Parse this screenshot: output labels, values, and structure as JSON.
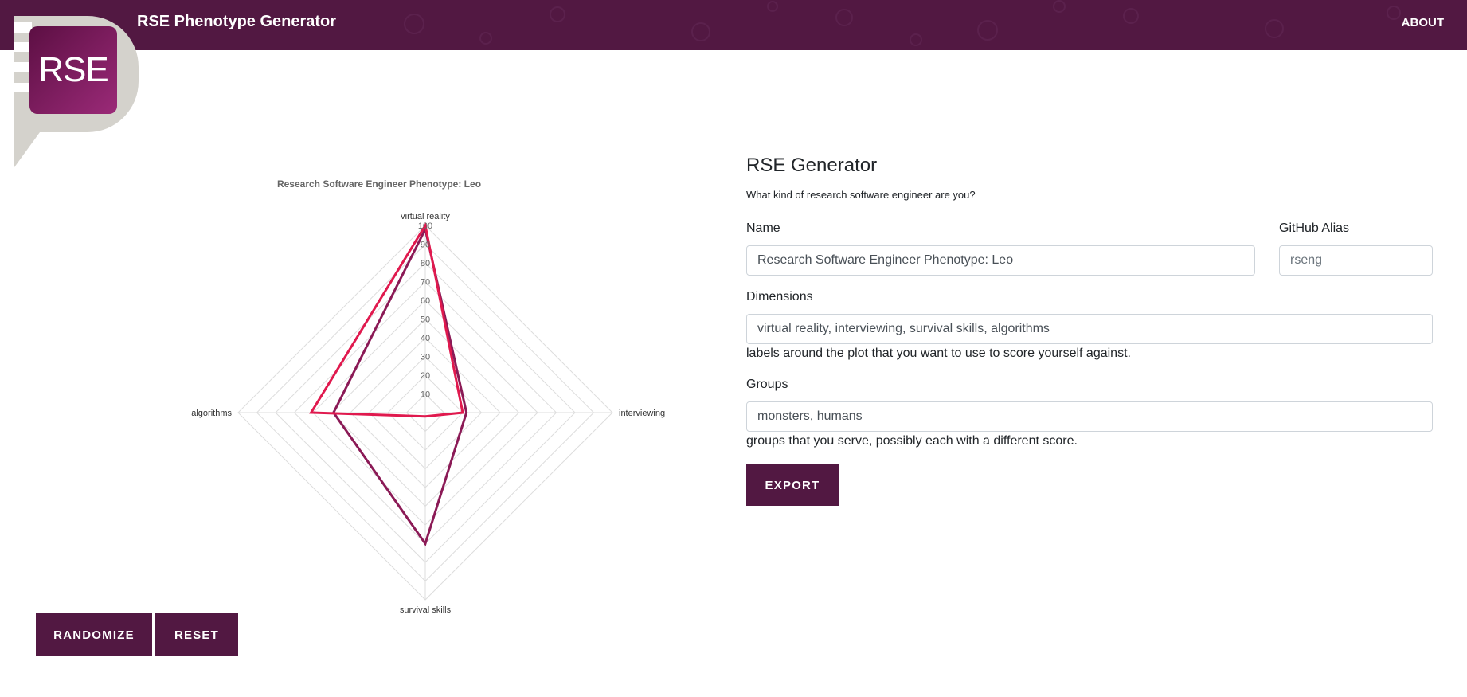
{
  "app": {
    "title": "RSE Phenotype Generator",
    "about_label": "ABOUT",
    "logo_text": "RSE",
    "brand_color": "#521842"
  },
  "chart_data": {
    "type": "radar",
    "title": "Research Software Engineer Phenotype: Leo",
    "axes": [
      "virtual reality",
      "interviewing",
      "survival skills",
      "algorithms"
    ],
    "ticks": [
      "10",
      "20",
      "30",
      "40",
      "50",
      "60",
      "70",
      "80",
      "90",
      "100"
    ],
    "range": [
      0,
      100
    ],
    "grid": true,
    "legend_position": "top-left",
    "series": [
      {
        "name": "monsters",
        "values": [
          100,
          20,
          2,
          61
        ],
        "color": "#e0194e"
      },
      {
        "name": "humans",
        "values": [
          98,
          22,
          70,
          49
        ],
        "color": "#8b1a56"
      }
    ]
  },
  "controls": {
    "randomize_label": "RANDOMIZE",
    "reset_label": "RESET"
  },
  "form": {
    "title": "RSE Generator",
    "subtitle": "What kind of research software engineer are you?",
    "name_label": "Name",
    "name_value": "Research Software Engineer Phenotype: Leo",
    "github_label": "GitHub Alias",
    "github_placeholder": "rseng",
    "dimensions_label": "Dimensions",
    "dimensions_value": "virtual reality, interviewing, survival skills, algorithms",
    "dimensions_help": "labels around the plot that you want to use to score yourself against.",
    "groups_label": "Groups",
    "groups_value": "monsters, humans",
    "groups_help": "groups that you serve, possibly each with a different score.",
    "export_label": "EXPORT"
  }
}
